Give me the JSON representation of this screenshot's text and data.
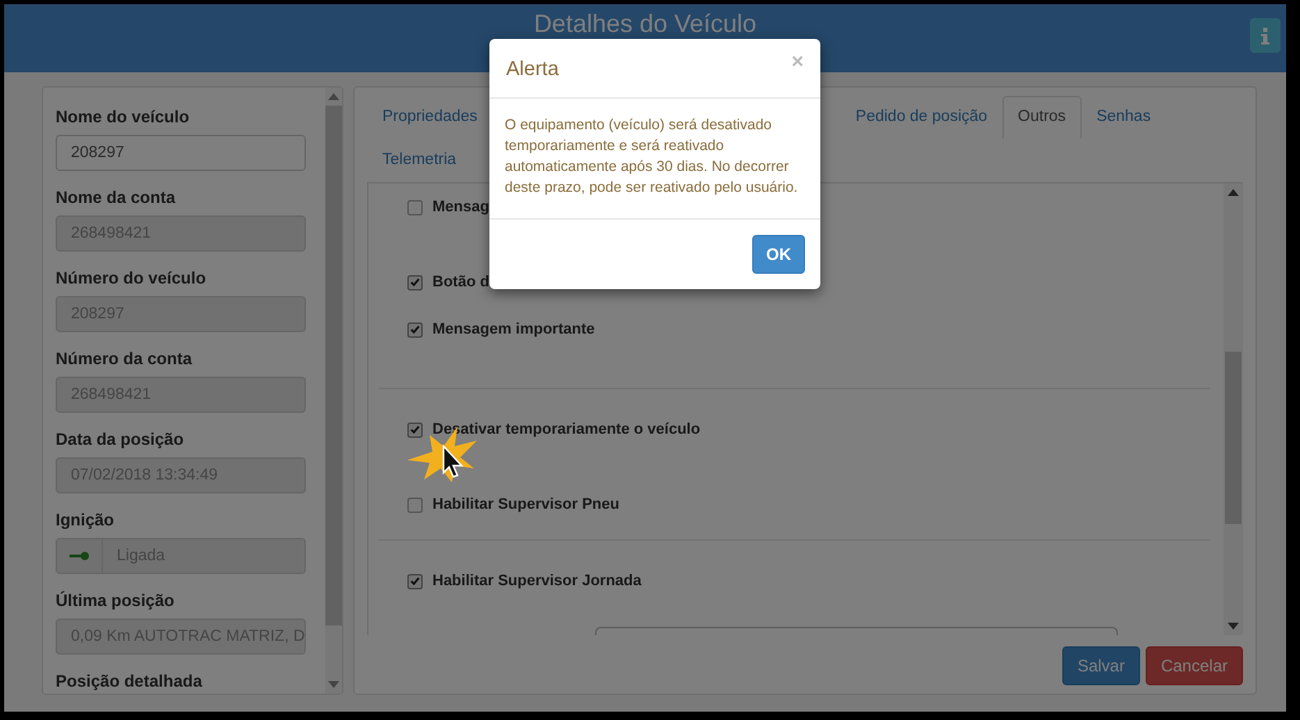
{
  "window": {
    "title": "Detalhes do Veículo"
  },
  "vehicle_fields": [
    {
      "kind": "text",
      "label": "Nome do veículo",
      "value": "208297",
      "disabled": false
    },
    {
      "kind": "text",
      "label": "Nome da conta",
      "value": "268498421",
      "disabled": true
    },
    {
      "kind": "text",
      "label": "Número do veículo",
      "value": "208297",
      "disabled": true
    },
    {
      "kind": "text",
      "label": "Número da conta",
      "value": "268498421",
      "disabled": true
    },
    {
      "kind": "text",
      "label": "Data da posição",
      "value": "07/02/2018 13:34:49",
      "disabled": true
    },
    {
      "kind": "ignition",
      "label": "Ignição",
      "value": "Ligada",
      "disabled": true
    },
    {
      "kind": "text",
      "label": "Última posição",
      "value": "0,09 Km AUTOTRAC MATRIZ, D",
      "disabled": true
    },
    {
      "kind": "heading",
      "label": "Posição detalhada"
    }
  ],
  "tabs": [
    {
      "label": "Propriedades",
      "selected": false
    },
    {
      "label": "Pedido de posição",
      "selected": false
    },
    {
      "label": "Outros",
      "selected": true
    },
    {
      "label": "Senhas",
      "selected": false
    },
    {
      "label": "Telemetria",
      "selected": false
    }
  ],
  "option_groups": [
    [
      {
        "label": "Mensag",
        "checked": false
      },
      {
        "label": "Botão d",
        "checked": true
      },
      {
        "label": "Mensagem importante",
        "checked": true
      }
    ],
    [
      {
        "label": "Desativar temporariamente o veículo",
        "checked": true
      },
      {
        "label": "Habilitar Supervisor Pneu",
        "checked": false
      }
    ],
    [
      {
        "label": "Habilitar Supervisor Jornada",
        "checked": true
      }
    ]
  ],
  "buttons": [
    {
      "label": "Salvar",
      "kind": "primary"
    },
    {
      "label": "Cancelar",
      "kind": "danger"
    }
  ],
  "alert": {
    "title": "Alerta",
    "close": "×",
    "message": "O equipamento (veículo) será desativado temporariamente e será reativado automaticamente após 30 dias. No decorrer deste prazo, pode ser reativado pelo usuário.",
    "button": "OK"
  }
}
